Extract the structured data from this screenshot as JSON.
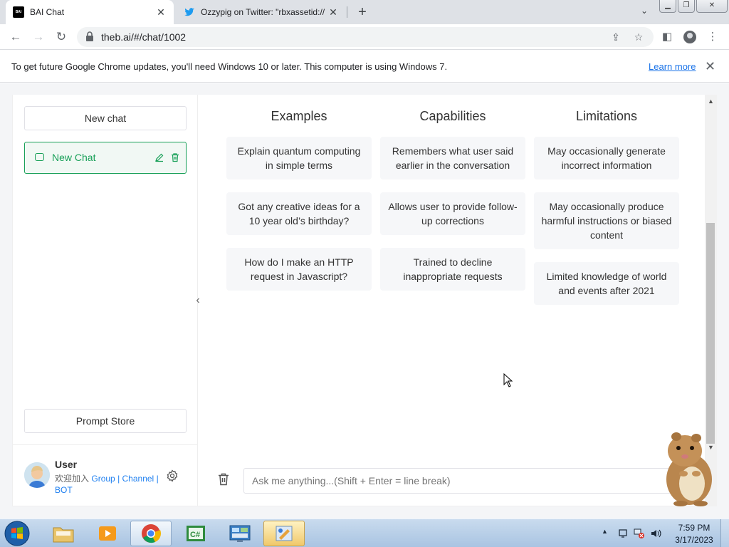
{
  "browser": {
    "tabs": [
      {
        "title": "BAI Chat",
        "favicon": "bai-logo-icon",
        "active": true
      },
      {
        "title": "Ozzypig on Twitter: \"rbxassetid://",
        "favicon": "twitter-icon",
        "active": false
      }
    ],
    "url": "theb.ai/#/chat/1002",
    "bai_favicon_text": "BAI"
  },
  "infobar": {
    "message": "To get future Google Chrome updates, you'll need Windows 10 or later. This computer is using Windows 7.",
    "learn_more": "Learn more"
  },
  "sidebar": {
    "new_chat_button": "New chat",
    "chats": [
      {
        "title": "New Chat",
        "selected": true
      }
    ],
    "prompt_store_button": "Prompt Store",
    "user": {
      "name": "User",
      "links_prefix": "欢迎加入",
      "links": [
        "Group",
        "Channel",
        "BOT"
      ]
    }
  },
  "main": {
    "columns": [
      {
        "heading": "Examples",
        "cards": [
          "Explain quantum computing in simple terms",
          "Got any creative ideas for a 10 year old’s birthday?",
          "How do I make an HTTP request in Javascript?"
        ]
      },
      {
        "heading": "Capabilities",
        "cards": [
          "Remembers what user said earlier in the conversation",
          "Allows user to provide follow-up corrections",
          "Trained to decline inappropriate requests"
        ]
      },
      {
        "heading": "Limitations",
        "cards": [
          "May occasionally generate incorrect information",
          "May occasionally produce harmful instructions or biased content",
          "Limited knowledge of world and events after 2021"
        ]
      }
    ],
    "input_placeholder": "Ask me anything...(Shift + Enter = line break)"
  },
  "taskbar": {
    "apps": [
      "explorer",
      "media-player",
      "chrome",
      "csharp-ide",
      "control-panel",
      "paint"
    ],
    "time": "7:59 PM",
    "date": "3/17/2023"
  },
  "colors": {
    "accent": "#18a058",
    "link": "#2080f0",
    "chrome_link": "#1a73e8"
  }
}
